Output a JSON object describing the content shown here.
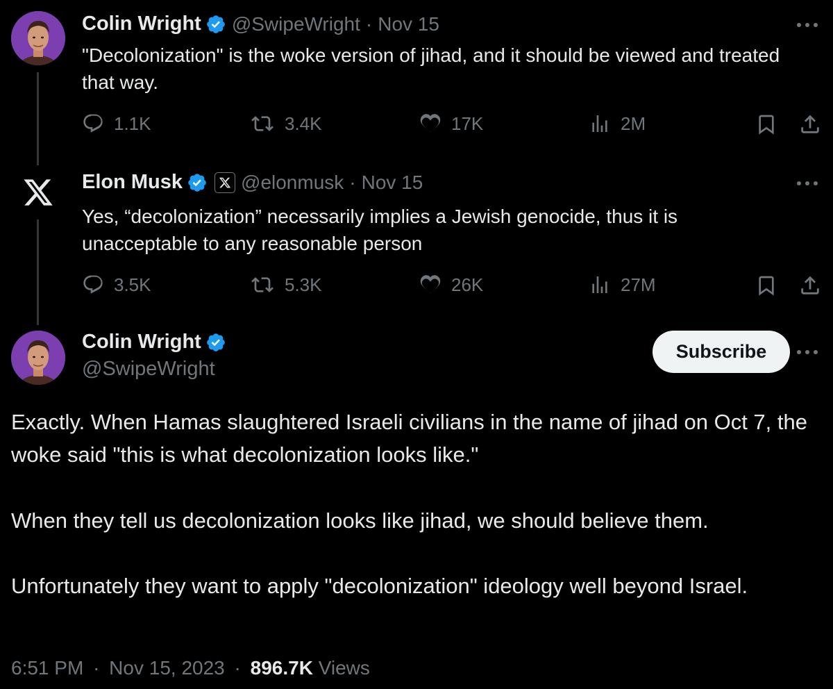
{
  "tweet1": {
    "name": "Colin Wright",
    "handle": "@SwipeWright",
    "separator": "·",
    "date": "Nov 15",
    "text": "\"Decolonization\" is the woke version of jihad, and it should be viewed and treated that way.",
    "stats": {
      "replies": "1.1K",
      "reposts": "3.4K",
      "likes": "17K",
      "views": "2M"
    }
  },
  "tweet2": {
    "name": "Elon Musk",
    "handle": "@elonmusk",
    "separator": "·",
    "date": "Nov 15",
    "text": "Yes, “decolonization” necessarily implies a Jewish genocide, thus it is unacceptable to any reasonable person",
    "stats": {
      "replies": "3.5K",
      "reposts": "5.3K",
      "likes": "26K",
      "views": "27M"
    }
  },
  "main": {
    "name": "Colin Wright",
    "handle": "@SwipeWright",
    "subscribe_label": "Subscribe",
    "paragraphs": [
      "Exactly. When Hamas slaughtered Israeli civilians in the name of jihad on Oct 7, the woke said \"this is what decolonization looks like.\"",
      "When they tell us decolonization looks like jihad, we should believe them.",
      "Unfortunately they want to apply \"decolonization\" ideology well beyond Israel."
    ],
    "time": "6:51 PM",
    "separator": "·",
    "date": "Nov 15, 2023",
    "views_count": "896.7K",
    "views_label": "Views"
  },
  "colors": {
    "background": "#000000",
    "text": "#e7e9ea",
    "muted": "#71767b",
    "verified_blue": "#1d9bf0",
    "avatar_bg": "#7b3fb0"
  },
  "icons": [
    "verified-badge-icon",
    "x-logo-icon",
    "reply-icon",
    "repost-icon",
    "like-icon",
    "views-icon",
    "bookmark-icon",
    "share-icon",
    "more-icon"
  ]
}
